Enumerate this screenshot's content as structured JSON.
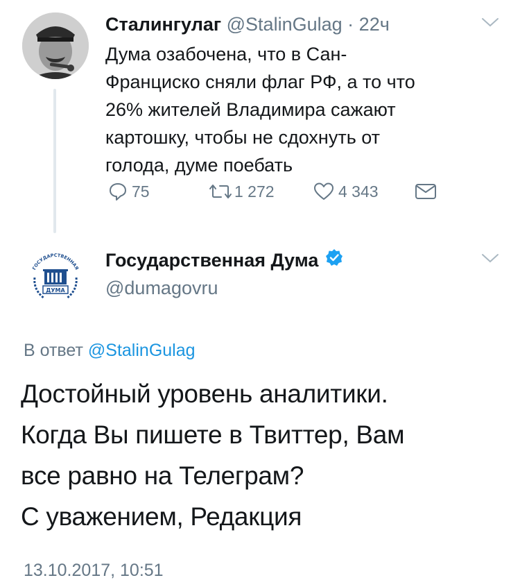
{
  "tweet1": {
    "author_name": "Сталингулаг",
    "author_handle": "@StalinGulag",
    "separator": "·",
    "time": "22ч",
    "text_lines": [
      "Дума озабочена, что в Сан-",
      "Франциско сняли флаг РФ, а то что",
      "26% жителей Владимира сажают",
      "картошку, чтобы не сдохнуть от",
      "голода, думе поебать"
    ],
    "actions": {
      "replies": "75",
      "retweets": "1 272",
      "likes": "4 343"
    },
    "icons": {
      "reply": "reply-icon",
      "retweet": "retweet-icon",
      "like": "heart-icon",
      "message": "envelope-icon",
      "menu": "chevron-down-icon"
    }
  },
  "tweet2": {
    "author_name": "Государственная Дума",
    "author_handle": "@dumagovru",
    "avatar_label": "ДУМА",
    "avatar_arc_text": "ГОСУДАРСТВЕННАЯ",
    "verified_icon": "verified-badge-icon",
    "reply_prefix": "В ответ",
    "reply_to": "@StalinGulag",
    "text_lines": [
      "Достойный уровень аналитики.",
      "Когда Вы пишете в Твиттер, Вам",
      "все равно на Телеграм?",
      "С уважением, Редакция"
    ],
    "timestamp": "13.10.2017, 10:51"
  },
  "colors": {
    "text": "#14171a",
    "secondary": "#657786",
    "link": "#1b95e0",
    "verified": "#1da1f2",
    "thread_line": "#e1e8ed",
    "duma_blue": "#1f4f8f"
  }
}
